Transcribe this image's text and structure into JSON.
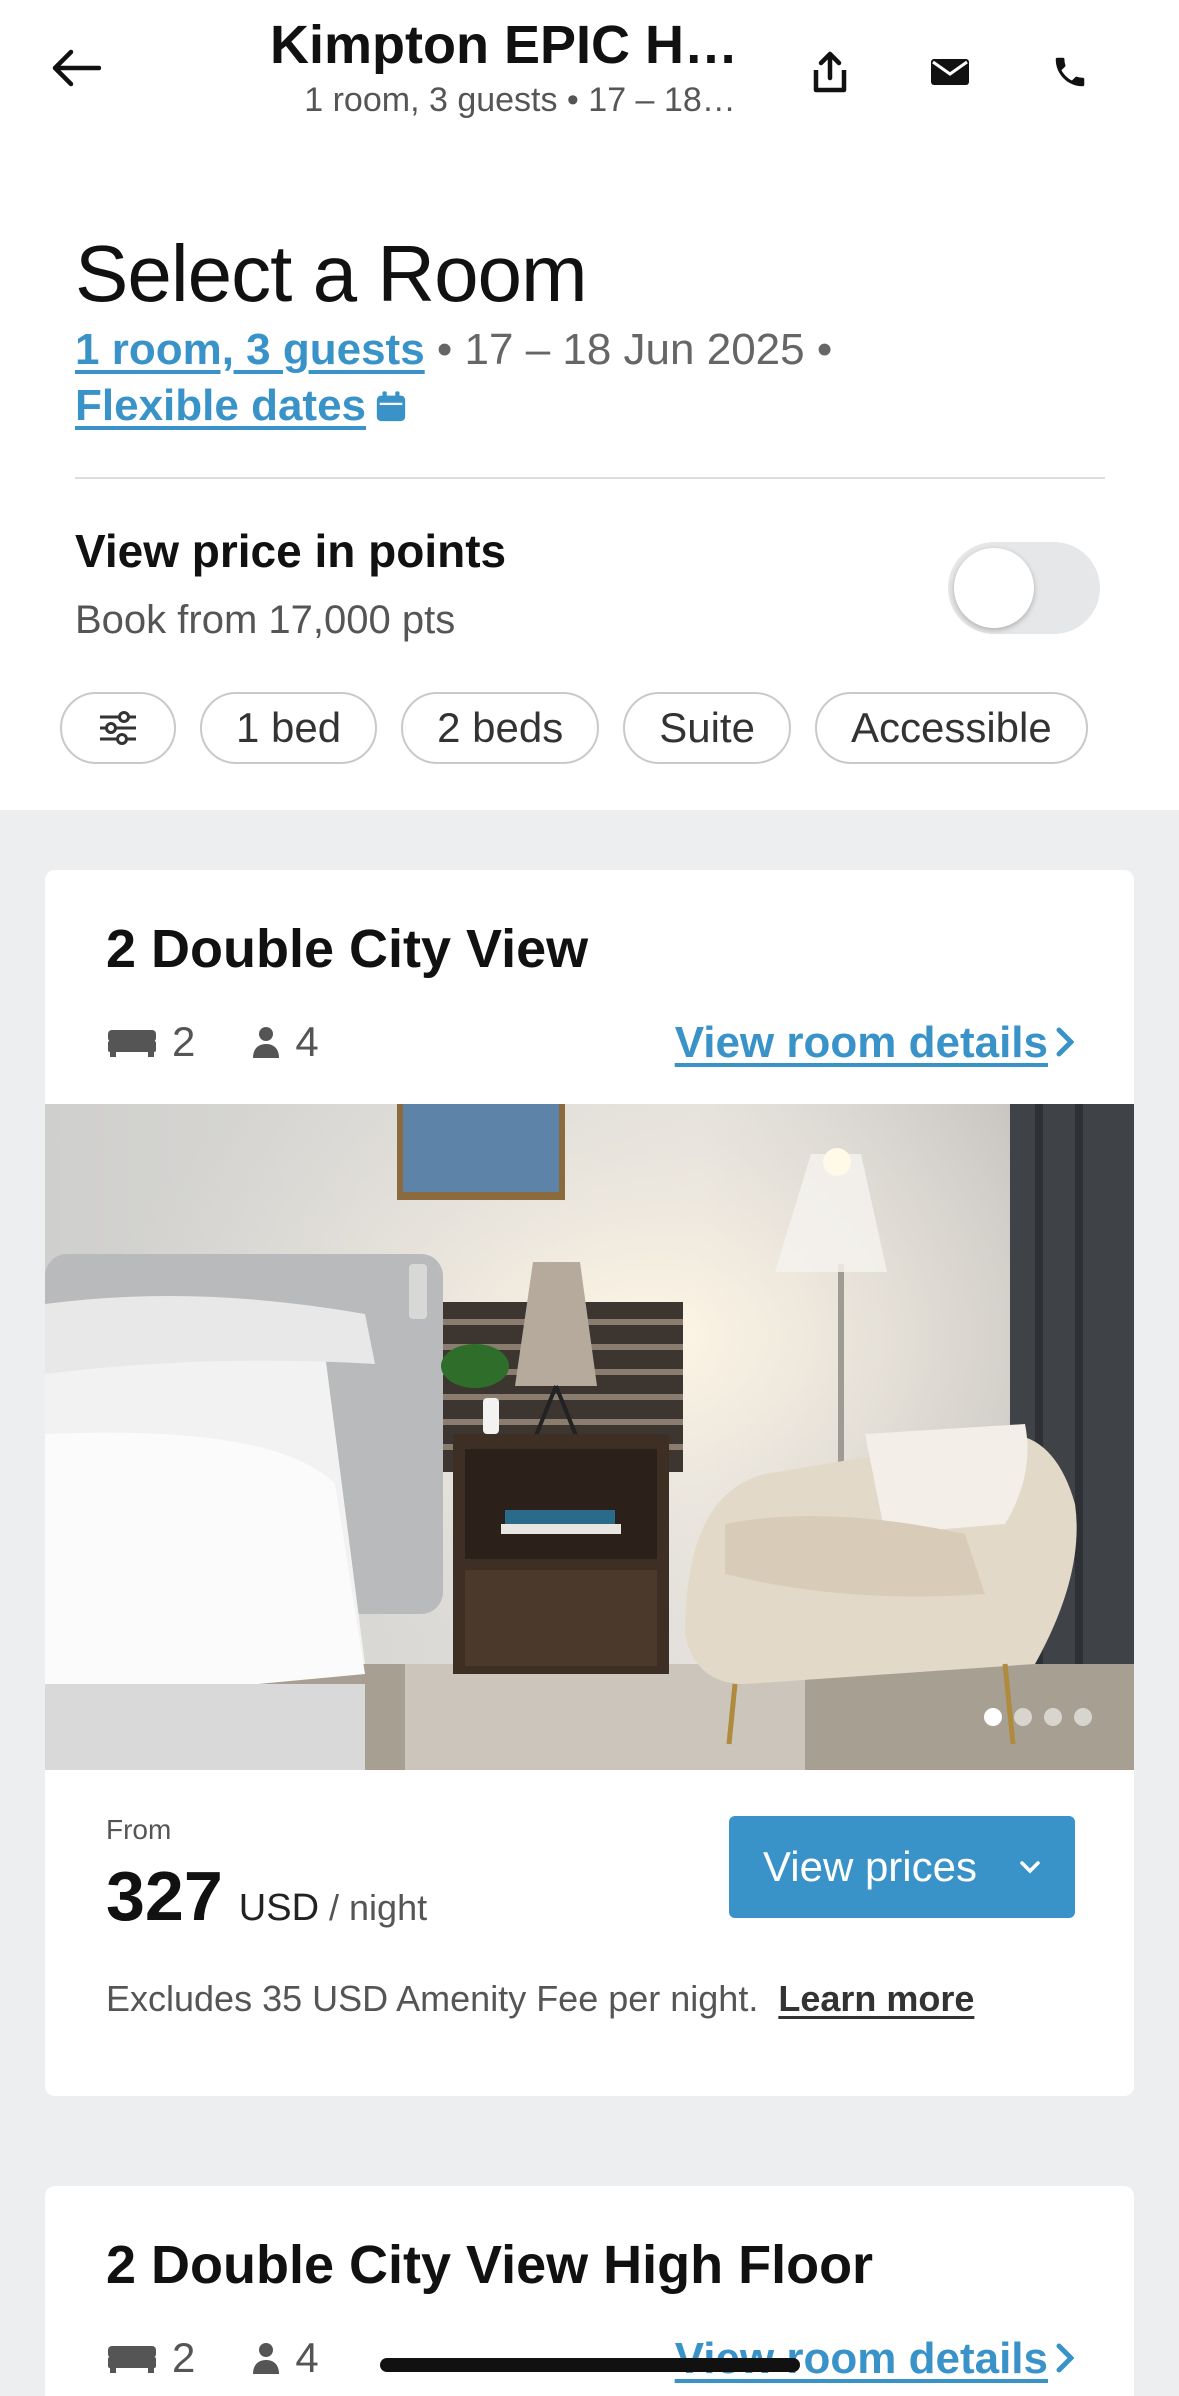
{
  "nav": {
    "title": "Kimpton EPIC Ho…",
    "subtitle": "1 room, 3 guests • 17 – 18…"
  },
  "header": {
    "title": "Select a Room",
    "guests_link": "1 room, 3 guests",
    "dates": " • 17 – 18 Jun 2025 •",
    "flexible_link": "Flexible dates"
  },
  "points": {
    "title": "View price in points",
    "subtitle": "Book from 17,000 pts",
    "enabled": false
  },
  "filters": [
    "1 bed",
    "2 beds",
    "Suite",
    "Accessible"
  ],
  "rooms": [
    {
      "name": "2 Double City View",
      "beds": "2",
      "guests": "4",
      "details_link": "View room details",
      "from_label": "From",
      "price": "327",
      "currency": "USD",
      "per": "/ night",
      "button": "View prices",
      "fee_note": "Excludes 35 USD Amenity Fee per night.",
      "learn_more": "Learn more",
      "photo_count": 4,
      "photo_index": 1
    },
    {
      "name": "2 Double City View High Floor",
      "beds": "2",
      "guests": "4",
      "details_link": "View room details"
    }
  ],
  "colors": {
    "accent": "#3a93c8",
    "list_bg": "#eceef0"
  }
}
